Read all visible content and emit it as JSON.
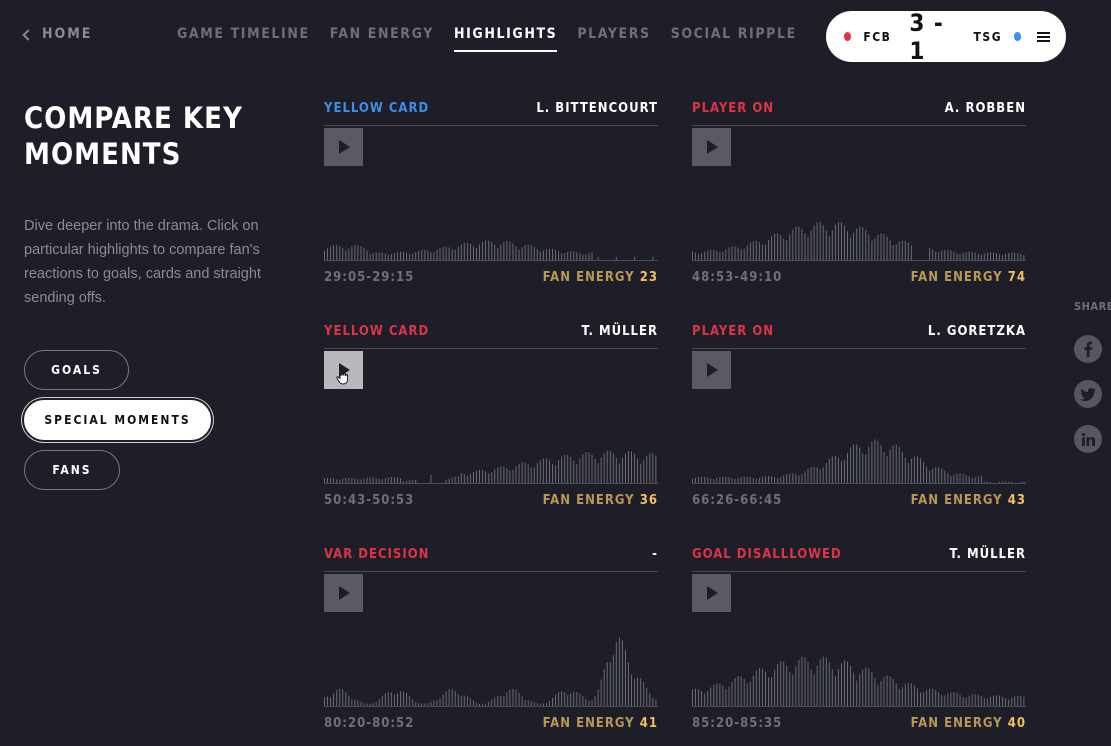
{
  "nav": {
    "home_label": "HOME",
    "tabs": [
      {
        "label": "GAME TIMELINE",
        "active": false
      },
      {
        "label": "FAN ENERGY",
        "active": false
      },
      {
        "label": "HIGHLIGHTS",
        "active": true
      },
      {
        "label": "PLAYERS",
        "active": false
      },
      {
        "label": "SOCIAL RIPPLE",
        "active": false
      }
    ]
  },
  "scoreboard": {
    "home_team": "FCB",
    "away_team": "TSG",
    "score": "3 - 1",
    "home_color": "#e0334a",
    "away_color": "#3d8fe8"
  },
  "intro": {
    "title_line1": "COMPARE KEY",
    "title_line2": "MOMENTS",
    "description": "Dive deeper into the drama. Click on particular highlights to compare fan's reactions to goals, cards and straight sending offs."
  },
  "filters": [
    {
      "label": "GOALS",
      "active": false
    },
    {
      "label": "SPECIAL MOMENTS",
      "active": true
    },
    {
      "label": "FANS",
      "active": false
    }
  ],
  "colors": {
    "accent_red": "#e0334a",
    "accent_blue": "#3d8fe8",
    "energy_gold": "#b99858",
    "energy_value": "#f0c060",
    "background": "#1d1e27"
  },
  "energy_label": "FAN ENERGY",
  "highlights": [
    {
      "event": "YELLOW CARD",
      "event_color": "#3d8fe8",
      "player": "L. BITTENCOURT",
      "time": "29:05-29:15",
      "energy": "23"
    },
    {
      "event": "PLAYER ON",
      "event_color": "#e0334a",
      "player": "A. ROBBEN",
      "time": "48:53-49:10",
      "energy": "74"
    },
    {
      "event": "YELLOW CARD",
      "event_color": "#e0334a",
      "player": "T. MÜLLER",
      "time": "50:43-50:53",
      "energy": "36"
    },
    {
      "event": "PLAYER ON",
      "event_color": "#e0334a",
      "player": "L. GORETZKA",
      "time": "66:26-66:45",
      "energy": "43"
    },
    {
      "event": "VAR DECISION",
      "event_color": "#e0334a",
      "player": "-",
      "time": "80:20-80:52",
      "energy": "41"
    },
    {
      "event": "GOAL DISALLLOWED",
      "event_color": "#e0334a",
      "player": "T. MÜLLER",
      "time": "85:20-85:35",
      "energy": "40"
    }
  ],
  "share": {
    "label": "SHARE",
    "icons": [
      "facebook-icon",
      "twitter-icon",
      "linkedin-icon"
    ]
  }
}
